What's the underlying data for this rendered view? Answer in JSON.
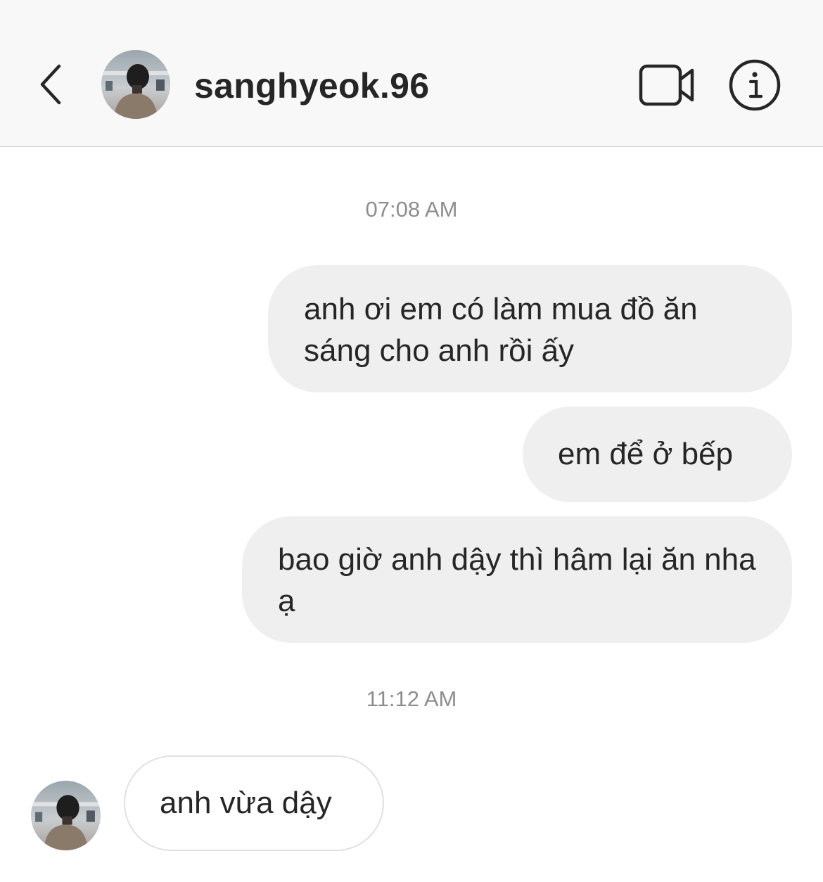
{
  "header": {
    "username": "sanghyeok.96",
    "back_icon": "chevron-left-icon",
    "video_icon": "video-camera-icon",
    "info_icon": "info-icon"
  },
  "messages": [
    {
      "type": "timestamp",
      "text": "07:08 AM"
    },
    {
      "type": "outgoing",
      "text": "anh ơi em có làm mua đồ ăn sáng cho anh rồi ấy"
    },
    {
      "type": "outgoing",
      "text": "em để ở bếp"
    },
    {
      "type": "outgoing",
      "text": "bao giờ anh dậy thì hâm lại ăn nha ạ"
    },
    {
      "type": "timestamp",
      "text": "11:12 AM"
    },
    {
      "type": "incoming",
      "text": "anh vừa dậy"
    }
  ],
  "colors": {
    "header_bg": "#f8f8f8",
    "outgoing_bubble": "#efefef",
    "incoming_bubble_border": "#e1e1e1",
    "timestamp_text": "#8e8e8e",
    "text": "#262626"
  }
}
